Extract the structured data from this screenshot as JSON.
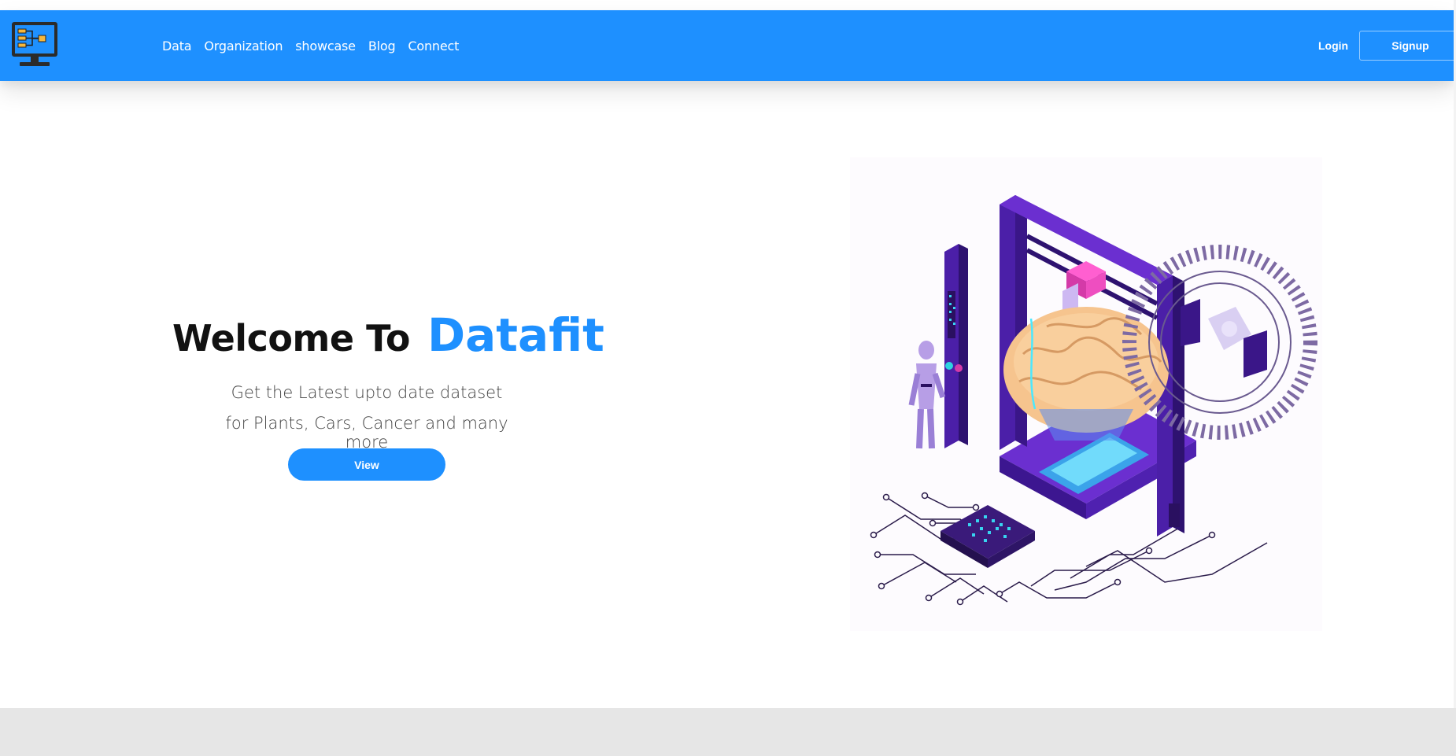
{
  "navbar": {
    "background": "#1e90ff",
    "logo_icon": "computer-monitor-network-icon",
    "links": [
      "Data",
      "Organization",
      "showcase",
      "Blog",
      "Connect"
    ],
    "login_label": "Login",
    "signup_label": "Signup"
  },
  "hero": {
    "welcome": "Welcome To",
    "brand": "Datafit",
    "brand_color": "#1e90ff",
    "subtitle_line1": "Get the Latest upto date dataset",
    "subtitle_line2": "for Plants, Cars, Cancer and many more",
    "view_label": "View",
    "illustration": "isometric-3d-printer-brain-robot-circuit-illustration"
  }
}
